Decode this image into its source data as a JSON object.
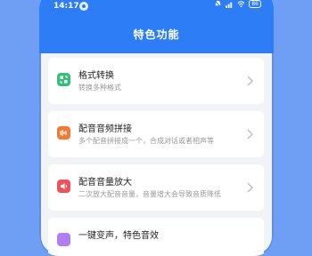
{
  "status_bar": {
    "time": "14:17",
    "battery": "86"
  },
  "page": {
    "title": "特色功能"
  },
  "features": [
    {
      "title": "格式转换",
      "desc": "转换多种格式",
      "icon": "format-convert-icon",
      "color": "#34c07a"
    },
    {
      "title": "配音音频拼接",
      "desc": "多个配音拼接成一个，合成对话或者相声等",
      "icon": "audio-splice-icon",
      "color": "#f47a33"
    },
    {
      "title": "配音音量放大",
      "desc": "二次放大配音音量，音量增大会导致音质降低",
      "icon": "volume-boost-icon",
      "color": "#f0515a"
    },
    {
      "title": "一键变声，特色音效",
      "desc": "",
      "icon": "voice-change-icon",
      "color": "#b07ef0"
    }
  ]
}
